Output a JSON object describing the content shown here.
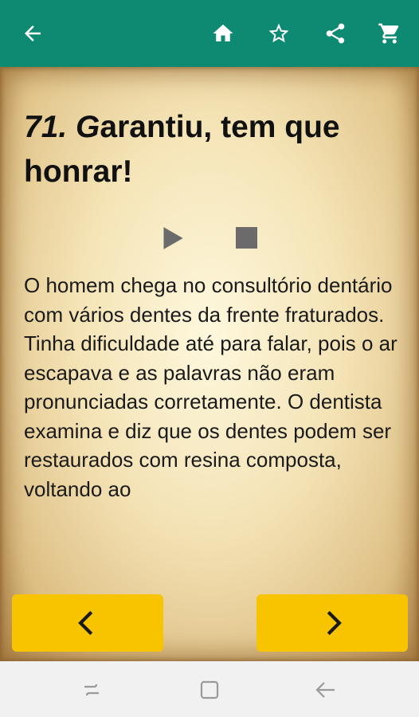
{
  "app_bar": {
    "icons": [
      "back-arrow-icon",
      "home-icon",
      "star-outline-icon",
      "share-icon",
      "cart-icon"
    ],
    "background_color": "#0f8a72",
    "icon_color": "#ffffff"
  },
  "story": {
    "number": "71. G",
    "title_rest": "arantiu, tem que honrar!",
    "body": "O homem chega no consultório dentário com vários dentes da frente fraturados. Tinha dificuldade até para falar, pois o ar escapava e as palavras não eram pronunciadas corretamente. O dentista examina e diz que os dentes podem ser restaurados com resina composta, voltando ao"
  },
  "media_controls": {
    "icons": [
      "play-icon",
      "stop-icon"
    ],
    "color": "#6b6b6b"
  },
  "navigation": {
    "prev_icon": "chevron-left-icon",
    "next_icon": "chevron-right-icon",
    "button_color": "#f8c400"
  },
  "system_nav": {
    "icons": [
      "recent-apps-icon",
      "home-square-icon",
      "system-back-icon"
    ]
  }
}
